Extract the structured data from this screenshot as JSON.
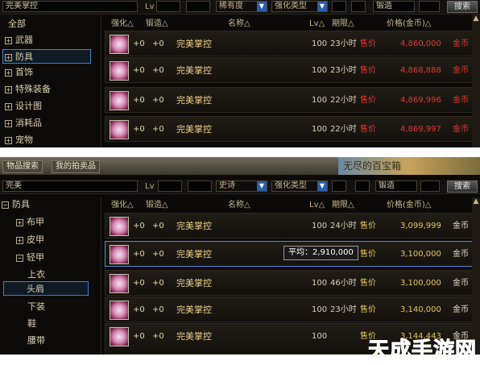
{
  "top": {
    "search": {
      "name_value": "完美掌控",
      "lv_label": "Lv",
      "rarity": "稀有度",
      "enhance": "强化类型",
      "spin_value": "锻造",
      "search_btn": "搜索"
    },
    "tree": [
      {
        "label": "全部",
        "pm": ""
      },
      {
        "label": "武器",
        "pm": "+"
      },
      {
        "label": "防具",
        "pm": "+"
      },
      {
        "label": "首饰",
        "pm": "+"
      },
      {
        "label": "特殊装备",
        "pm": "+"
      },
      {
        "label": "设计图",
        "pm": "+"
      },
      {
        "label": "消耗品",
        "pm": "+"
      },
      {
        "label": "宠物",
        "pm": "+"
      }
    ],
    "headers": {
      "enhance": "强化△",
      "forge": "锻造△",
      "name": "名称△",
      "lv": "Lv△",
      "time": "期限△",
      "price": "价格(金币)△"
    },
    "rows": [
      {
        "enh": "+0",
        "forge": "+0",
        "name": "完美掌控",
        "lv": "100",
        "time": "23小时",
        "sale": "售价",
        "price": "4,860,000",
        "coin": "金币"
      },
      {
        "enh": "+0",
        "forge": "+0",
        "name": "完美掌控",
        "lv": "100",
        "time": "23小时",
        "sale": "售价",
        "price": "4,868,888",
        "coin": "金币"
      },
      {
        "enh": "+0",
        "forge": "+0",
        "name": "完美掌控",
        "lv": "100",
        "time": "22小时",
        "sale": "售价",
        "price": "4,869,996",
        "coin": "金币"
      },
      {
        "enh": "+0",
        "forge": "+0",
        "name": "完美掌控",
        "lv": "100",
        "time": "22小时",
        "sale": "售价",
        "price": "4,869,997",
        "coin": "金币"
      }
    ]
  },
  "bottom": {
    "tabs": [
      "物品搜索",
      "我的拍卖品"
    ],
    "banner": "无尽的百宝箱",
    "search": {
      "name_value": "完美",
      "lv_label": "Lv",
      "rarity": "史诗",
      "enhance": "强化类型",
      "spin_value": "锻造",
      "search_btn": "搜索"
    },
    "tree": [
      {
        "label": "防具",
        "pm": "−"
      },
      {
        "label": "布甲",
        "pm": "+"
      },
      {
        "label": "皮甲",
        "pm": "+"
      },
      {
        "label": "轻甲",
        "pm": "−"
      },
      {
        "label": "上衣",
        "pm": ""
      },
      {
        "label": "头肩",
        "pm": ""
      },
      {
        "label": "下装",
        "pm": ""
      },
      {
        "label": "鞋",
        "pm": ""
      },
      {
        "label": "腰带",
        "pm": ""
      }
    ],
    "headers": {
      "enhance": "强化△",
      "forge": "锻造△",
      "name": "名称△",
      "lv": "Lv△",
      "time": "期限△",
      "price": "价格(金币)△"
    },
    "rows": [
      {
        "enh": "+0",
        "forge": "+0",
        "name": "完美掌控",
        "lv": "100",
        "time": "24小时",
        "sale": "售价",
        "price": "3,099,999",
        "coin": "金币"
      },
      {
        "enh": "+0",
        "forge": "+0",
        "name": "完美掌控",
        "lv": "100",
        "time": "22小时",
        "sale": "售价",
        "price": "3,100,000",
        "coin": "金币"
      },
      {
        "enh": "+0",
        "forge": "+0",
        "name": "完美掌控",
        "lv": "100",
        "time": "46小时",
        "sale": "售价",
        "price": "3,100,000",
        "coin": "金币"
      },
      {
        "enh": "+0",
        "forge": "+0",
        "name": "完美掌控",
        "lv": "100",
        "time": "23小时",
        "sale": "售价",
        "price": "3,140,000",
        "coin": "金币"
      },
      {
        "enh": "+0",
        "forge": "+0",
        "name": "完美掌控",
        "lv": "100",
        "time": "",
        "sale": "售价",
        "price": "3,144,443",
        "coin": "金币"
      }
    ],
    "tooltip": "平均：2,910,000"
  },
  "watermark": "天成手游网",
  "colors": {
    "sale_red": "#e23a2a",
    "price_gold": "#e8c45a",
    "select_blue": "#3d7fd0"
  }
}
